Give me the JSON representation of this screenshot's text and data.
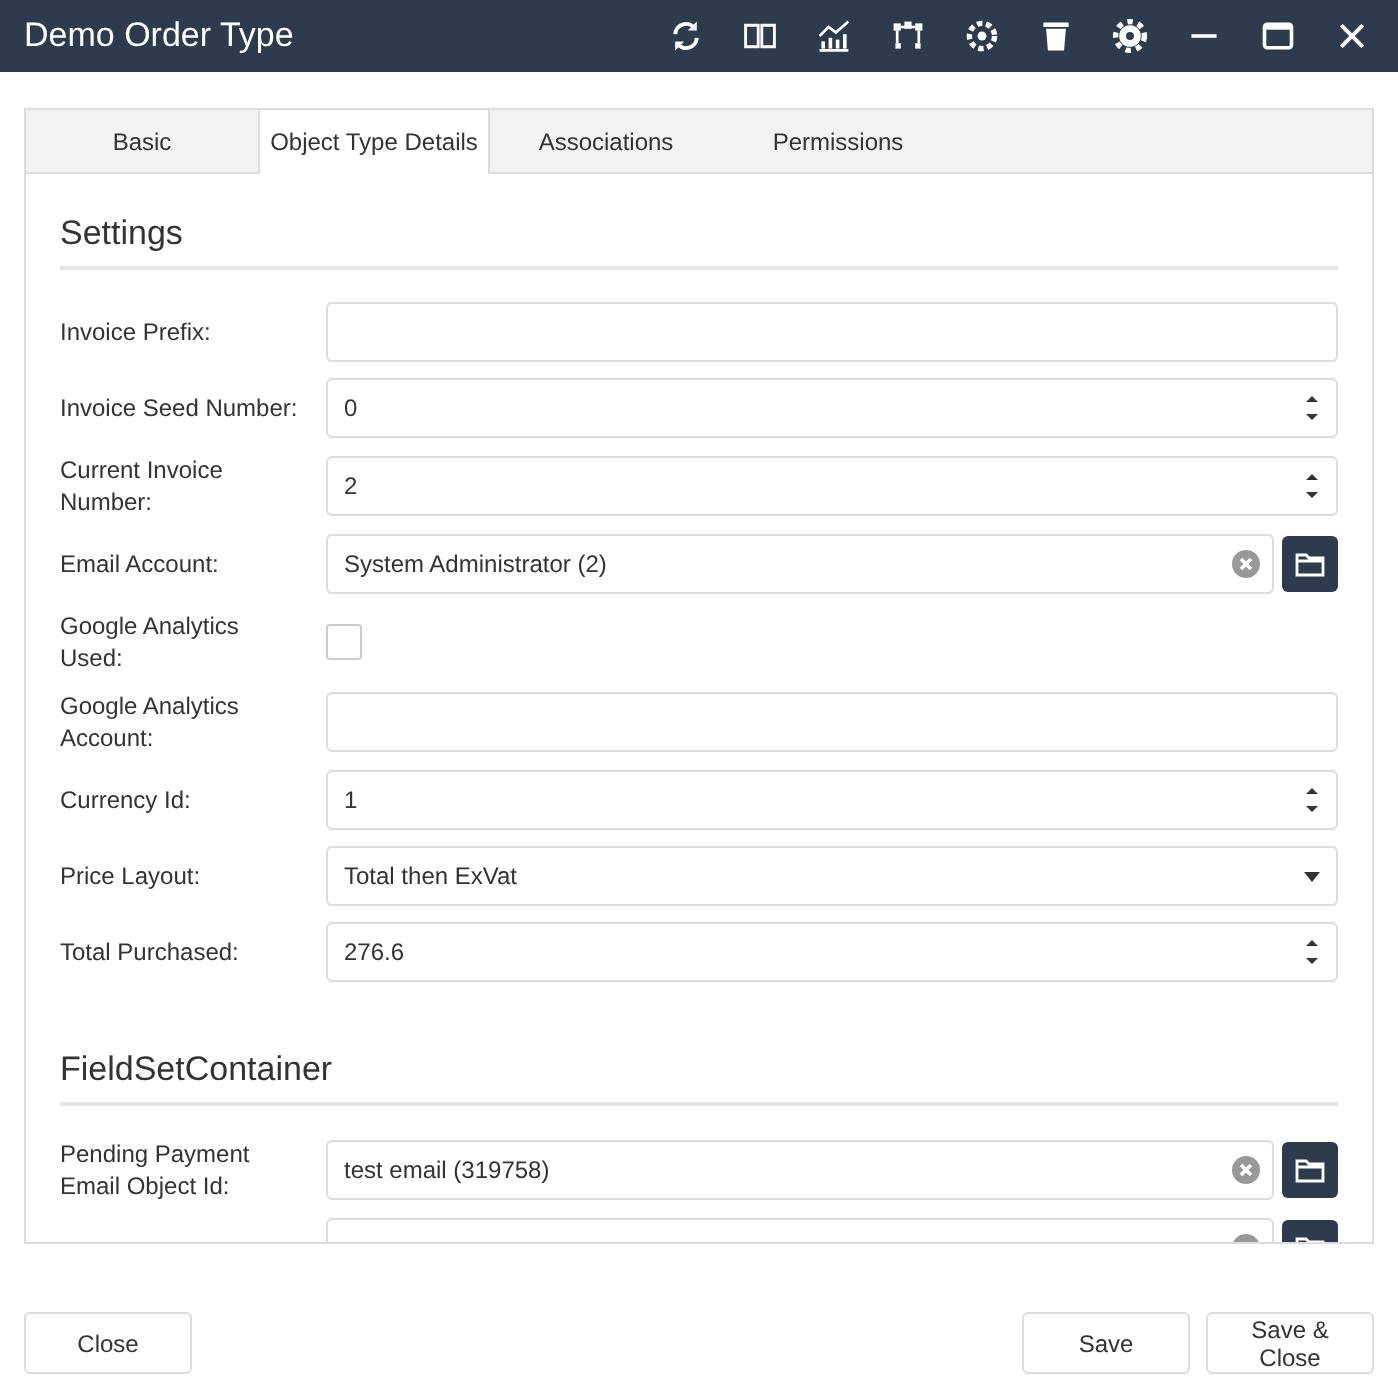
{
  "window": {
    "title": "Demo Order Type"
  },
  "tabs": [
    {
      "label": "Basic",
      "selected": false
    },
    {
      "label": "Object Type Details",
      "selected": true
    },
    {
      "label": "Associations",
      "selected": false
    },
    {
      "label": "Permissions",
      "selected": false
    }
  ],
  "sections": [
    {
      "title": "Settings",
      "fields": [
        {
          "label": "Invoice Prefix:",
          "kind": "text"
        },
        {
          "label": "Invoice Seed Number:",
          "kind": "number",
          "value": "0"
        },
        {
          "label": "Current Invoice Number:",
          "kind": "number",
          "value": "2"
        },
        {
          "label": "Email Account:",
          "kind": "picker",
          "value": "System Administrator (2)"
        },
        {
          "label": "Google Analytics Used:",
          "kind": "checkbox",
          "checked": false
        },
        {
          "label": "Google Analytics Account:",
          "kind": "text"
        },
        {
          "label": "Currency Id:",
          "kind": "number",
          "value": "1"
        },
        {
          "label": "Price Layout:",
          "kind": "select",
          "value": "Total then ExVat"
        },
        {
          "label": "Total Purchased:",
          "kind": "number",
          "value": "276.6"
        }
      ]
    },
    {
      "title": "FieldSetContainer",
      "fields": [
        {
          "label": "Pending Payment Email Object Id:",
          "kind": "picker",
          "value": "test email (319758)"
        },
        {
          "kind": "picker"
        }
      ]
    }
  ],
  "footer": {
    "left": [
      "Close"
    ],
    "right": [
      "Save",
      "Save & Close"
    ]
  }
}
